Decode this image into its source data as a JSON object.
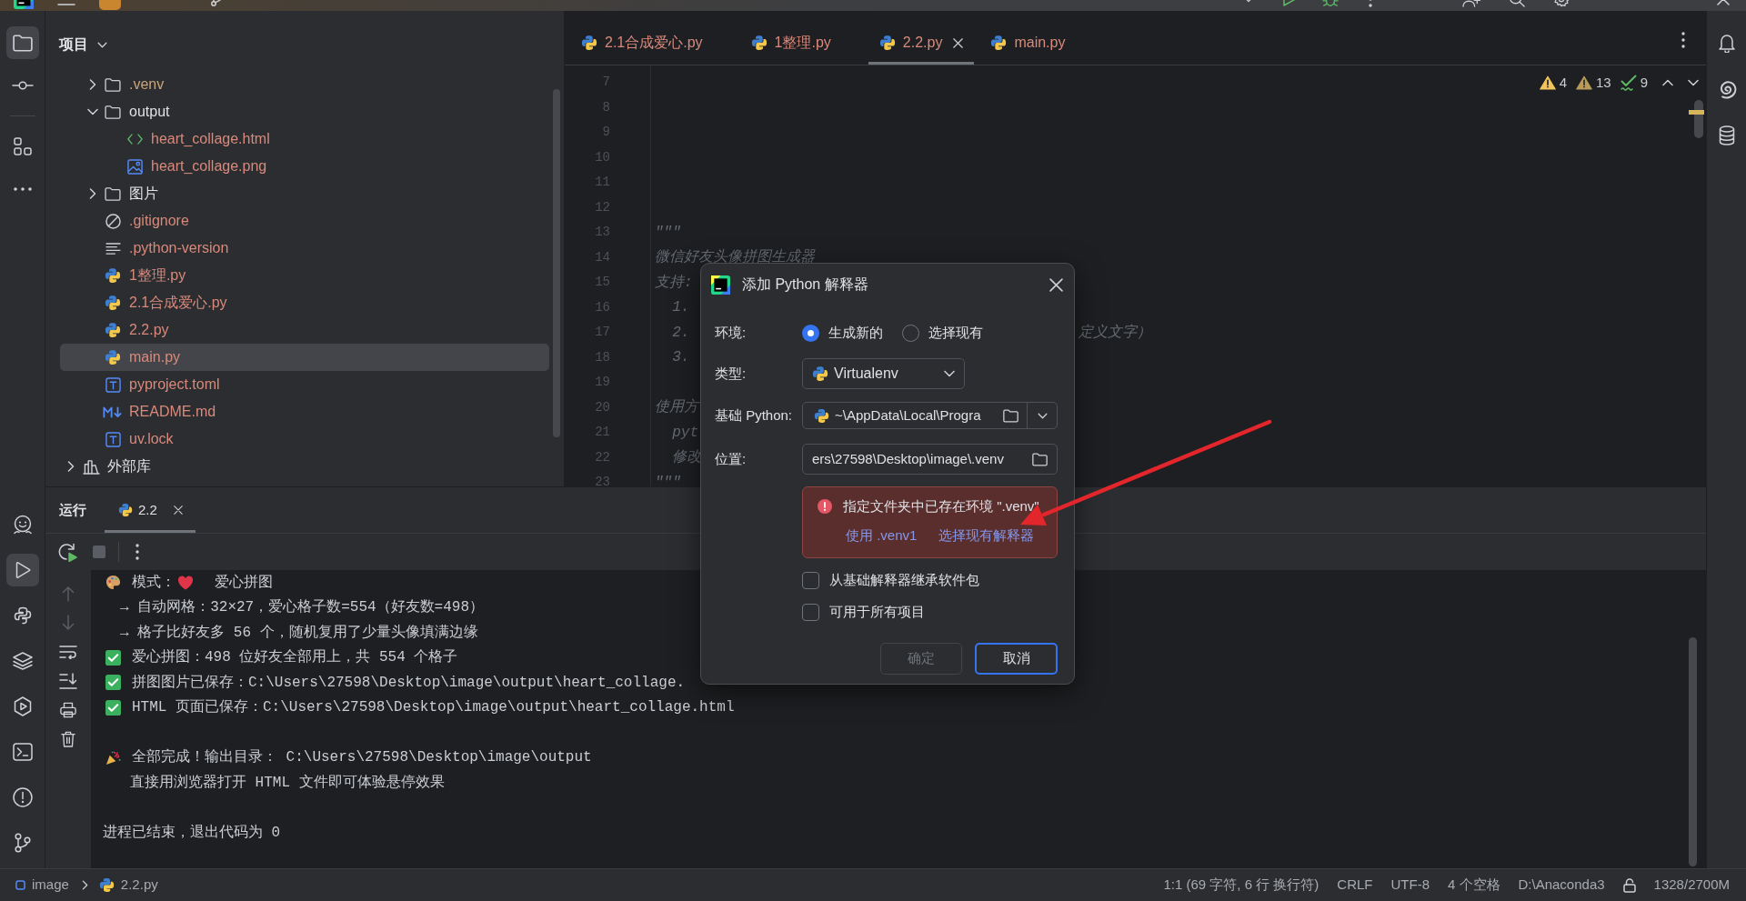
{
  "left_toolbar": {
    "top": [
      {
        "kind": "project",
        "selected": true
      },
      {
        "kind": "commit",
        "selected": false
      },
      {
        "kind": "structure",
        "selected": false
      },
      {
        "kind": "more",
        "selected": false
      }
    ],
    "bottom": [
      {
        "kind": "assistant",
        "selected": false
      },
      {
        "kind": "run",
        "selected": true
      },
      {
        "kind": "console",
        "selected": false
      },
      {
        "kind": "layers",
        "selected": false
      },
      {
        "kind": "services",
        "selected": false
      },
      {
        "kind": "terminal",
        "selected": false
      },
      {
        "kind": "problems",
        "selected": false
      },
      {
        "kind": "git",
        "selected": false
      }
    ]
  },
  "project_panel": {
    "title": "项目",
    "tree": [
      {
        "kind": "root",
        "children": [
          {
            "kind": "folder",
            "label": ".venv",
            "expanded": false,
            "selected": false,
            "color": "#c9a57a"
          },
          {
            "kind": "folder",
            "label": "output",
            "expanded": true,
            "selected": false,
            "color": "#dfe1e5",
            "children": [
              {
                "kind": "html",
                "label": "heart_collage.html",
                "selected": false,
                "color": "#d98a7c"
              },
              {
                "kind": "image",
                "label": "heart_collage.png",
                "selected": false,
                "color": "#d98a7c"
              }
            ]
          },
          {
            "kind": "folder",
            "label": "图片",
            "expanded": false,
            "selected": false,
            "color": "#dfe1e5"
          },
          {
            "kind": "ignore",
            "label": ".gitignore",
            "selected": false,
            "color": "#d98a7c"
          },
          {
            "kind": "text",
            "label": ".python-version",
            "selected": false,
            "color": "#d98a7c"
          },
          {
            "kind": "python",
            "label": "1整理.py",
            "selected": false,
            "color": "#d98a7c"
          },
          {
            "kind": "python",
            "label": "2.1合成爱心.py",
            "selected": false,
            "color": "#d98a7c"
          },
          {
            "kind": "python",
            "label": "2.2.py",
            "selected": false,
            "color": "#d98a7c"
          },
          {
            "kind": "python",
            "label": "main.py",
            "selected": true,
            "color": "#d98a7c"
          },
          {
            "kind": "toml",
            "label": "pyproject.toml",
            "selected": false,
            "color": "#d98a7c"
          },
          {
            "kind": "markdown",
            "label": "README.md",
            "selected": false,
            "color": "#d98a7c"
          },
          {
            "kind": "toml",
            "label": "uv.lock",
            "selected": false,
            "color": "#d98a7c"
          }
        ]
      },
      {
        "kind": "library",
        "label": "外部库",
        "expanded": false,
        "selected": false,
        "color": "#dfe1e5"
      }
    ]
  },
  "editor": {
    "tabs": [
      {
        "label": "2.1合成爱心.py",
        "selected": false
      },
      {
        "label": "1整理.py",
        "selected": false
      },
      {
        "label": "2.2.py",
        "selected": true
      },
      {
        "label": "main.py",
        "selected": false
      }
    ],
    "inspections": [
      {
        "kind": "warning",
        "count": "4"
      },
      {
        "kind": "weak",
        "count": "13"
      },
      {
        "kind": "typo",
        "count": "9"
      }
    ],
    "lines": [
      {
        "number": "7"
      },
      {
        "number": "8"
      },
      {
        "number": "9"
      },
      {
        "number": "10"
      },
      {
        "number": "11"
      },
      {
        "number": "12"
      },
      {
        "number": "13",
        "text": "\"\"\""
      },
      {
        "number": "14",
        "text": "微信好友头像拼图生成器"
      },
      {
        "number": "15",
        "text": "支持:"
      },
      {
        "number": "16",
        "text": "  1."
      },
      {
        "number": "17",
        "text": "  2.",
        "tail": "定义文字）"
      },
      {
        "number": "18",
        "text": "  3."
      },
      {
        "number": "19"
      },
      {
        "number": "20",
        "text": "使用方"
      },
      {
        "number": "21",
        "text": "  pyt"
      },
      {
        "number": "22",
        "text": "  修改"
      },
      {
        "number": "23",
        "text": "\"\"\""
      }
    ]
  },
  "right_toolbar": [
    {
      "kind": "notifications"
    },
    {
      "kind": "assistant"
    },
    {
      "kind": "database"
    }
  ],
  "run_panel": {
    "title": "运行",
    "tabs": [
      {
        "label": "2.2",
        "selected": true
      }
    ],
    "console": [
      {
        "kind": "mode",
        "label": "模式：",
        "text": "爱心拼图"
      },
      {
        "kind": "step",
        "text": "→ 自动网格：32×27，爱心格子数=554（好友数=498）"
      },
      {
        "kind": "step",
        "text": "→ 格子比好友多 56 个，随机复用了少量头像填满边缘"
      },
      {
        "kind": "success",
        "text": "爱心拼图：498 位好友全部用上，共 554 个格子"
      },
      {
        "kind": "success",
        "text": "拼图图片已保存：C:\\Users\\27598\\Desktop\\image\\output\\heart_collage."
      },
      {
        "kind": "success",
        "text": "HTML 页面已保存：C:\\Users\\27598\\Desktop\\image\\output\\heart_collage.html"
      },
      {
        "kind": "done",
        "text": "全部完成！输出目录： C:\\Users\\27598\\Desktop\\image\\output"
      },
      {
        "kind": "note",
        "text": "直接用浏览器打开 HTML 文件即可体验悬停效果"
      },
      {
        "kind": "exit",
        "text": "进程已结束，退出代码为 0"
      }
    ]
  },
  "dialog": {
    "title": "添加 Python 解释器",
    "environment": {
      "label": "环境:",
      "options": [
        {
          "label": "生成新的",
          "selected": true
        },
        {
          "label": "选择现有",
          "selected": false
        }
      ]
    },
    "type": {
      "label": "类型:",
      "value": "Virtualenv"
    },
    "base_python": {
      "label": "基础 Python:",
      "value": "~\\AppData\\Local\\Progra"
    },
    "location": {
      "label": "位置:",
      "value": "ers\\27598\\Desktop\\image\\.venv"
    },
    "error": {
      "message": "指定文件夹中已存在环境 \".venv\"",
      "actions": [
        "使用 .venv1",
        "选择现有解释器"
      ]
    },
    "checkboxes": [
      {
        "label": "从基础解释器继承软件包",
        "checked": false
      },
      {
        "label": "可用于所有项目",
        "checked": false
      }
    ],
    "buttons": [
      {
        "label": "确定",
        "disabled": true,
        "focused": false
      },
      {
        "label": "取消",
        "disabled": false,
        "focused": true
      }
    ]
  },
  "status_bar": {
    "breadcrumbs": [
      {
        "kind": "module",
        "label": "image"
      },
      {
        "kind": "python",
        "label": "2.2.py"
      }
    ],
    "position": "1:1 (69 字符, 6 行 换行符)",
    "line_separator": "CRLF",
    "encoding": "UTF-8",
    "indent": "4 个空格",
    "interpreter": "D:\\Anaconda3",
    "memory": "1328/2700M"
  }
}
